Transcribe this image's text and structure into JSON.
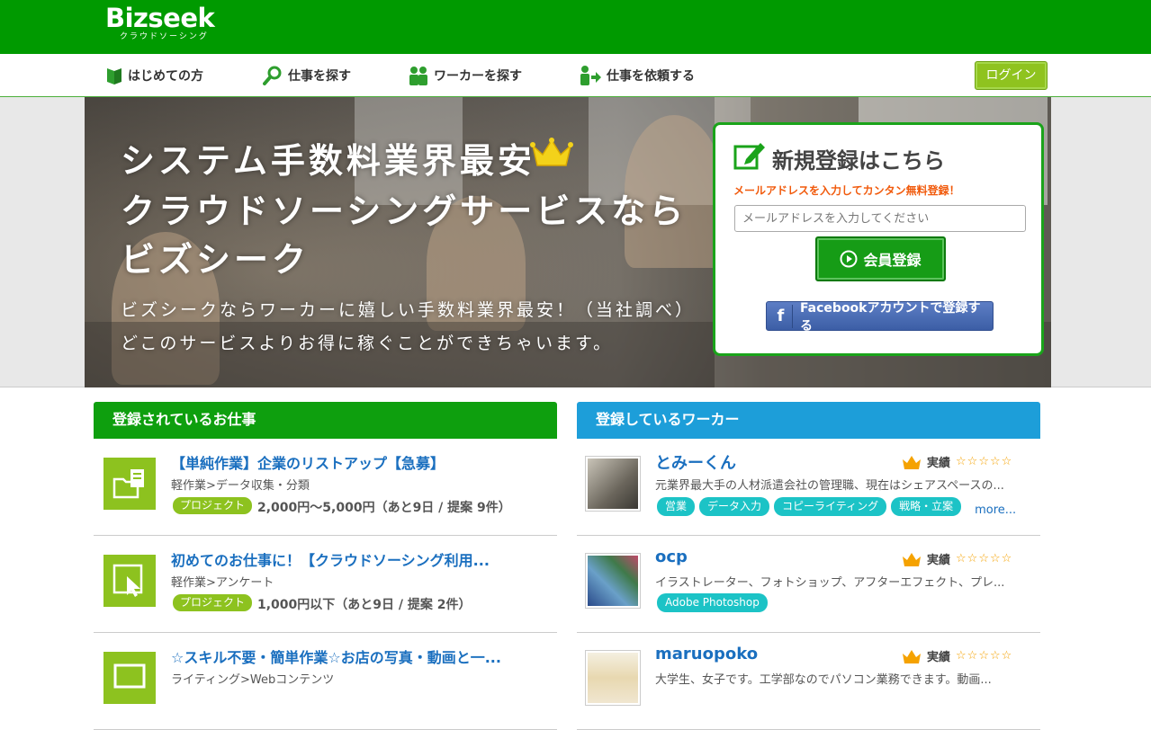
{
  "header": {
    "logo": "Bizseek",
    "logo_sub": "クラウドソーシング",
    "nav": [
      {
        "label": "はじめての方"
      },
      {
        "label": "仕事を探す"
      },
      {
        "label": "ワーカーを探す"
      },
      {
        "label": "仕事を依頼する"
      }
    ],
    "login_label": "ログイン"
  },
  "hero": {
    "line1": "システム手数料業界最安",
    "line2": "クラウドソーシングサービスなら",
    "line3": "ビズシーク",
    "sub1": "ビズシークならワーカーに嬉しい手数料業界最安！（当社調べ）",
    "sub2": "どこのサービスよりお得に稼ぐことができちゃいます。"
  },
  "signup": {
    "title": "新規登録はこちら",
    "note": "メールアドレスを入力してカンタン無料登録！",
    "email_placeholder": "メールアドレスを入力してください",
    "register_label": "会員登録",
    "facebook_label": "Facebookアカウントで登録する"
  },
  "jobs": {
    "heading": "登録されているお仕事",
    "items": [
      {
        "title": "【単純作業】企業のリストアップ【急募】",
        "category": "軽作業>データ収集・分類",
        "badge": "プロジェクト",
        "price": "2,000円〜5,000円（あと9日 / 提案 9件）",
        "icon": "folder-document-icon"
      },
      {
        "title": "初めてのお仕事に！【クラウドソーシング利用...",
        "category": "軽作業>アンケート",
        "badge": "プロジェクト",
        "price": "1,000円以下（あと9日 / 提案 2件）",
        "icon": "cursor-click-icon"
      },
      {
        "title": "☆スキル不要・簡単作業☆お店の写真・動画と一...",
        "category": "ライティング>Webコンテンツ",
        "badge": "",
        "price": "",
        "icon": "monitor-icon"
      }
    ]
  },
  "workers": {
    "heading": "登録しているワーカー",
    "rating_label": "実績",
    "stars": "☆☆☆☆☆",
    "more_label": "more...",
    "items": [
      {
        "name": "とみーくん",
        "desc": "元業界最大手の人材派遣会社の管理職、現在はシェアスペースの...",
        "tags": [
          "営業",
          "データ入力",
          "コピーライティング",
          "戦略・立案"
        ],
        "show_more": true
      },
      {
        "name": "ocp",
        "desc": "イラストレーター、フォトショップ、アフターエフェクト、プレ...",
        "tags": [
          "Adobe Photoshop"
        ],
        "show_more": false
      },
      {
        "name": "maruopoko",
        "desc": "大学生、女子です。工学部なのでパソコン業務できます。動画...",
        "tags": [],
        "show_more": false
      }
    ]
  },
  "colors": {
    "brand_green": "#009a00",
    "jobs_green": "#0e9f0e",
    "workers_blue": "#1d9ed9",
    "lime": "#8dc21f",
    "link_blue": "#1a6fbf",
    "tag_cyan": "#1cc3c6",
    "note_orange": "#f15a0c"
  }
}
